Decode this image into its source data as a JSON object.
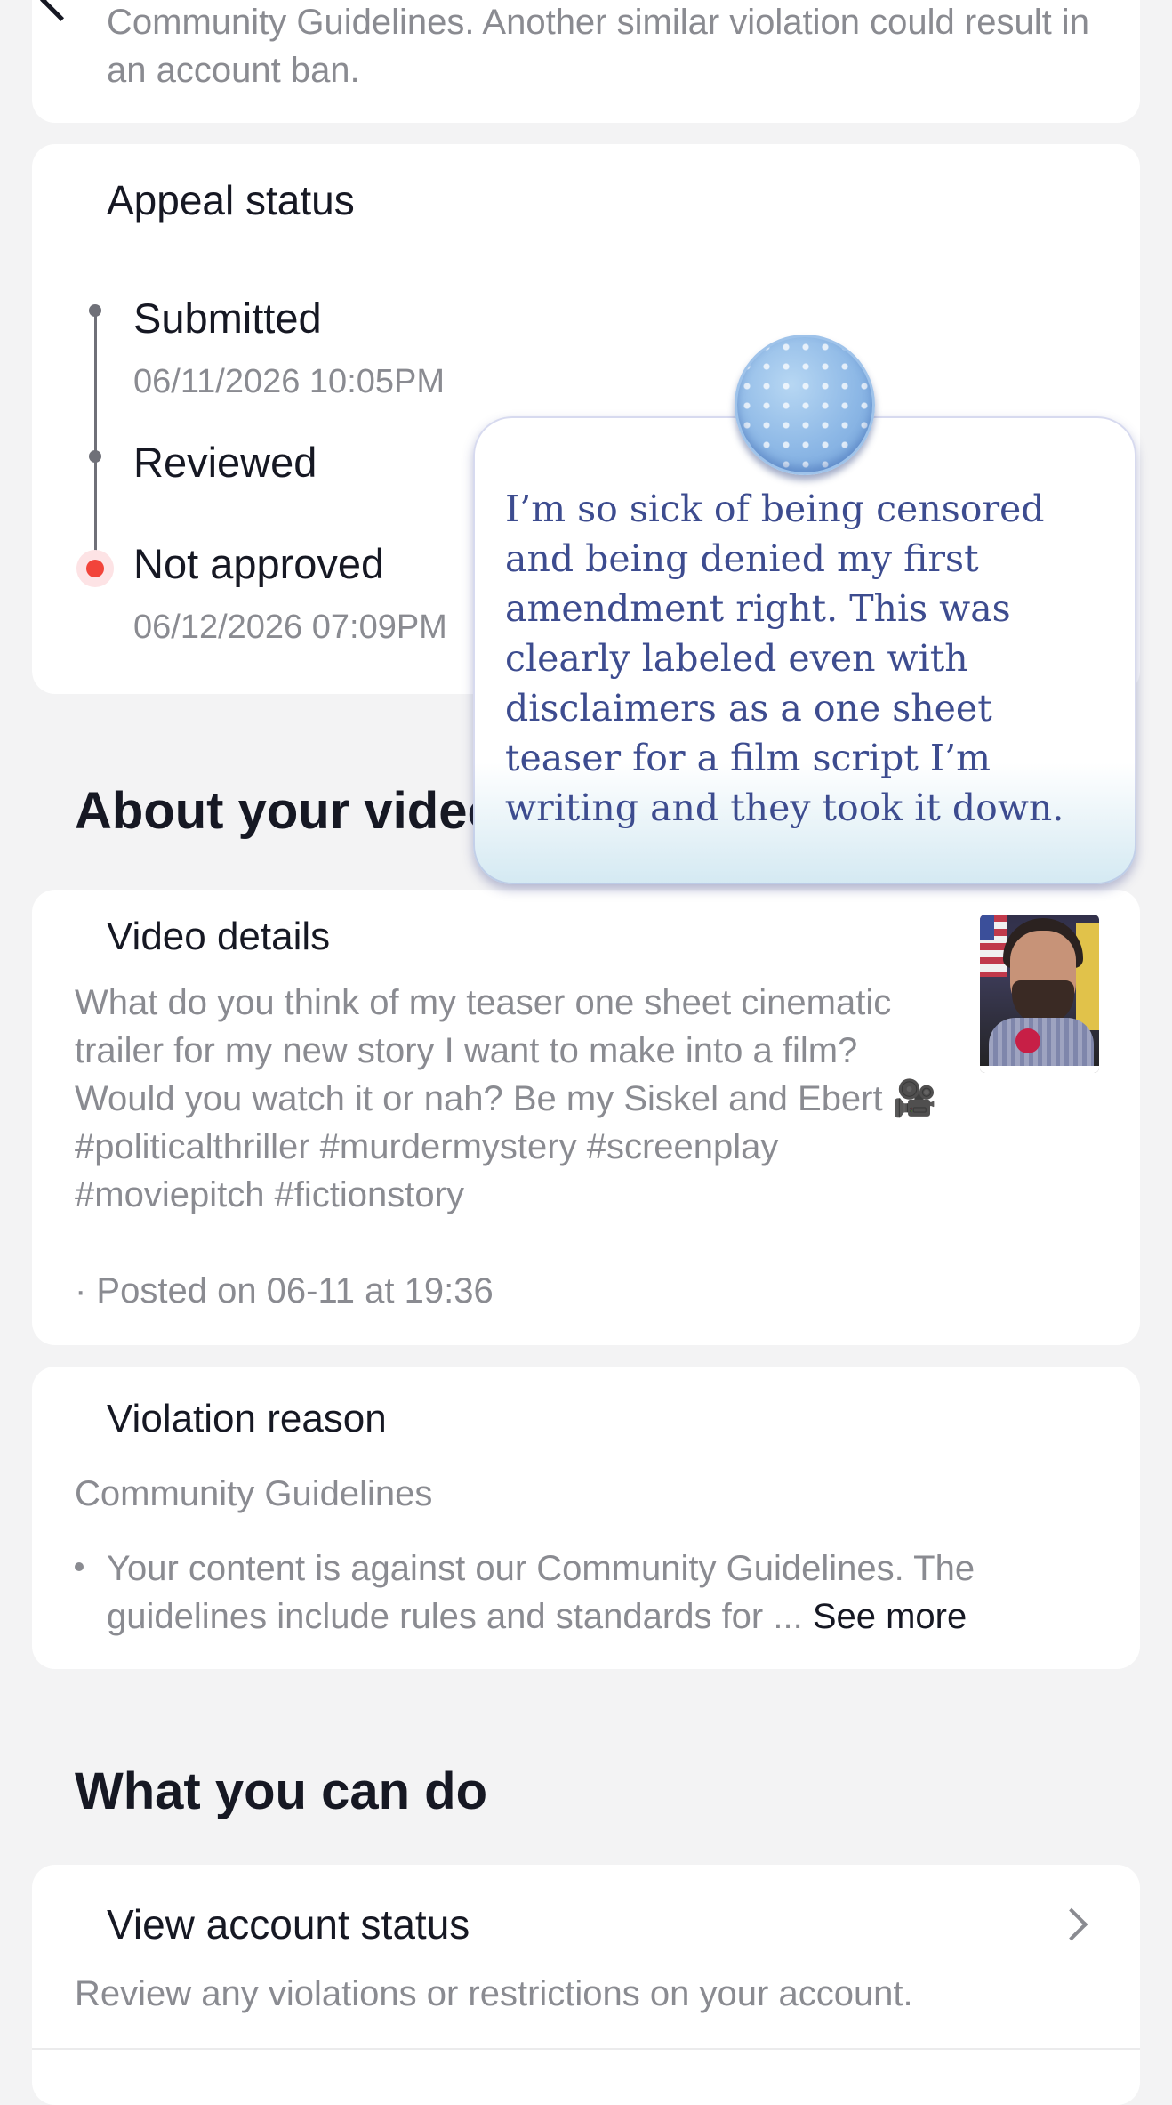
{
  "notice": {
    "partial_text": "Community Guidelines. Another similar violation could result in an account ban."
  },
  "appeal": {
    "title": "Appeal status",
    "steps": [
      {
        "label": "Submitted",
        "time": "06/11/2026 10:05PM"
      },
      {
        "label": "Reviewed",
        "time": ""
      },
      {
        "label": "Not approved",
        "time": "06/12/2026 07:09PM"
      }
    ],
    "status_colors": {
      "active": "#f2443a",
      "inactive": "#6f7078"
    }
  },
  "about": {
    "title": "About your video",
    "video_details": {
      "title": "Video details",
      "description": "What do you think of my teaser one sheet cinematic trailer for my new story I want to make into a film? Would you watch it or nah? Be my Siskel and Ebert 🎥 #politicalthriller #murdermystery #screenplay #moviepitch #fictionstory",
      "posted": "· Posted on 06-11 at 19:36"
    },
    "violation": {
      "title": "Violation reason",
      "category": "Community Guidelines",
      "bullet_text": "Your content is against our Community Guidelines. The guidelines include rules and standards for ...",
      "see_more": "See more"
    }
  },
  "actions": {
    "title": "What you can do",
    "items": [
      {
        "title": "View account status",
        "subtitle": "Review any violations or restrictions on your account.",
        "icon": "chevron-right-icon"
      }
    ]
  },
  "overlay_bubble": {
    "text": "I’m so sick of being censored and being denied my first amendment right. This was clearly labeled even with disclaimers as a one sheet teaser for a film script I’m writing and they took it down."
  }
}
